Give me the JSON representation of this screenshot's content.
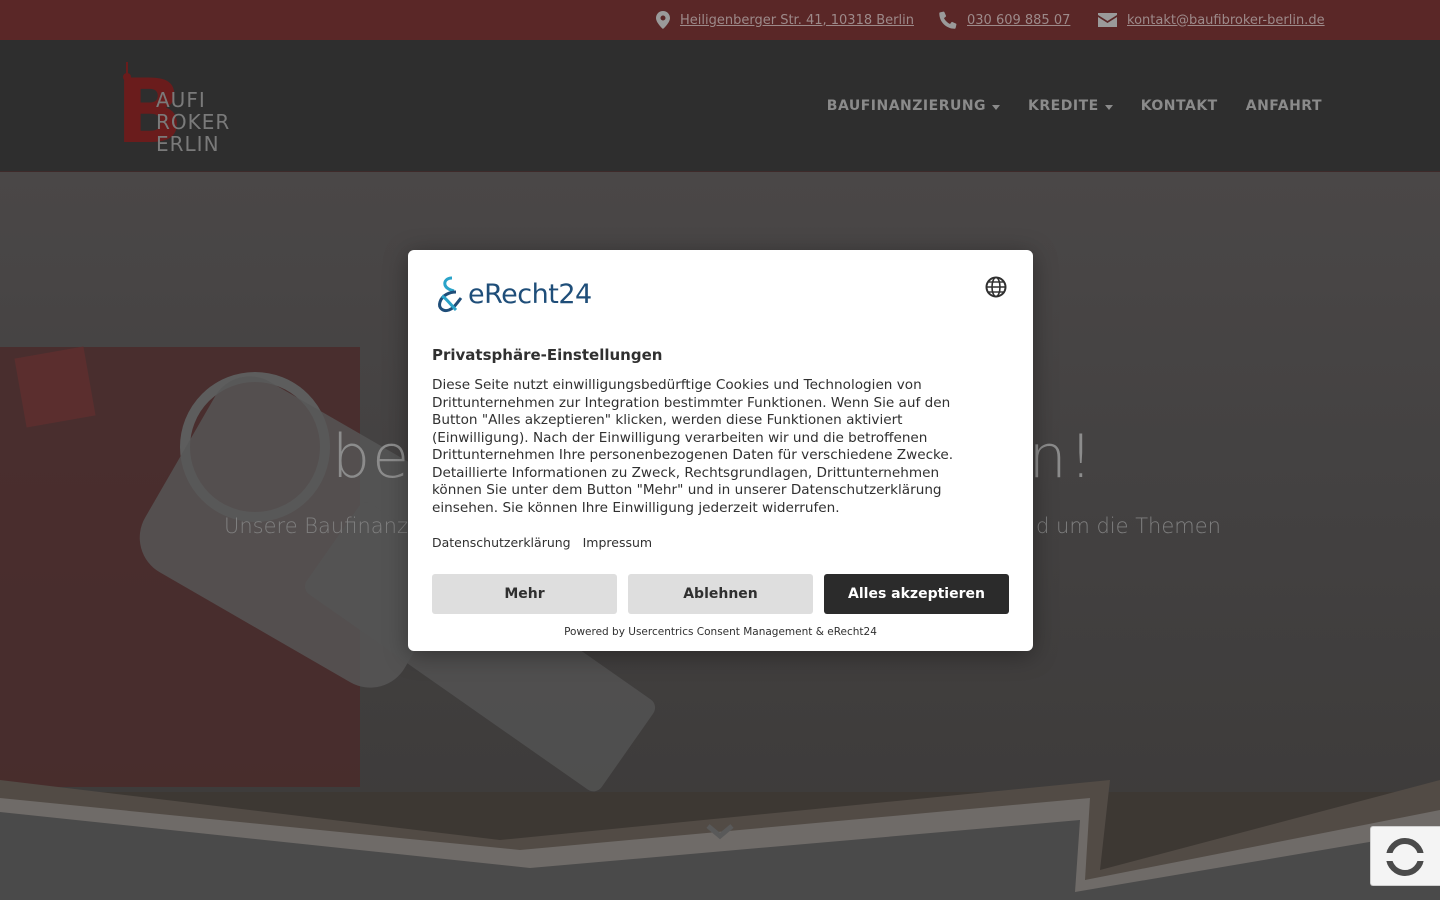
{
  "topbar": {
    "address": "Heiligenberger Str. 41, 10318 Berlin",
    "phone": "030 609 885 07",
    "email": "kontakt@baufibroker-berlin.de"
  },
  "logo": {
    "letter": "B",
    "line1": "AUFI",
    "line2": "ROKER",
    "line3": "ERLIN"
  },
  "nav": {
    "items": [
      {
        "label": "BAUFINANZIERUNG",
        "dropdown": true
      },
      {
        "label": "KREDITE",
        "dropdown": true
      },
      {
        "label": "KONTAKT",
        "dropdown": false
      },
      {
        "label": "ANFAHRT",
        "dropdown": false
      }
    ]
  },
  "hero": {
    "title_left": "be",
    "title_right": "in!",
    "subtitle_left": "Unsere Baufinanz",
    "subtitle_right": "d um die Themen"
  },
  "consent": {
    "brand": "eRecht24",
    "title": "Privatsphäre-Einstellungen",
    "text": "Diese Seite nutzt einwilligungsbedürftige Cookies und Technologien von Drittunternehmen zur Integration bestimmter Funktionen. Wenn Sie auf den Button \"Alles akzeptieren\" klicken, werden diese Funktionen aktiviert (Einwilligung). Nach der Einwilligung verarbeiten wir und die betroffenen Drittunternehmen Ihre personenbezogenen Daten für verschiedene Zwecke. Detaillierte Informationen zu Zweck, Rechtsgrundlagen, Drittunternehmen können Sie unter dem Button \"Mehr\" und in unserer Datenschutzerklärung einsehen. Sie können Ihre Einwilligung jederzeit widerrufen.",
    "link_privacy": "Datenschutzerklärung",
    "link_imprint": "Impressum",
    "btn_more": "Mehr",
    "btn_decline": "Ablehnen",
    "btn_accept": "Alles akzeptieren",
    "powered_by": "Powered by Usercentrics Consent Management & eRecht24"
  },
  "colors": {
    "topbar_bg": "#5a2727",
    "header_bg": "#2e2e2e",
    "accent_red": "#6a1c1c",
    "brand_blue": "#1f4e79",
    "button_dark": "#2b2b2b",
    "button_light": "#dedede"
  },
  "icons": {
    "address": "map-marker-icon",
    "phone": "phone-icon",
    "email": "envelope-icon",
    "language": "globe-icon",
    "scroll": "chevron-down-icon"
  }
}
